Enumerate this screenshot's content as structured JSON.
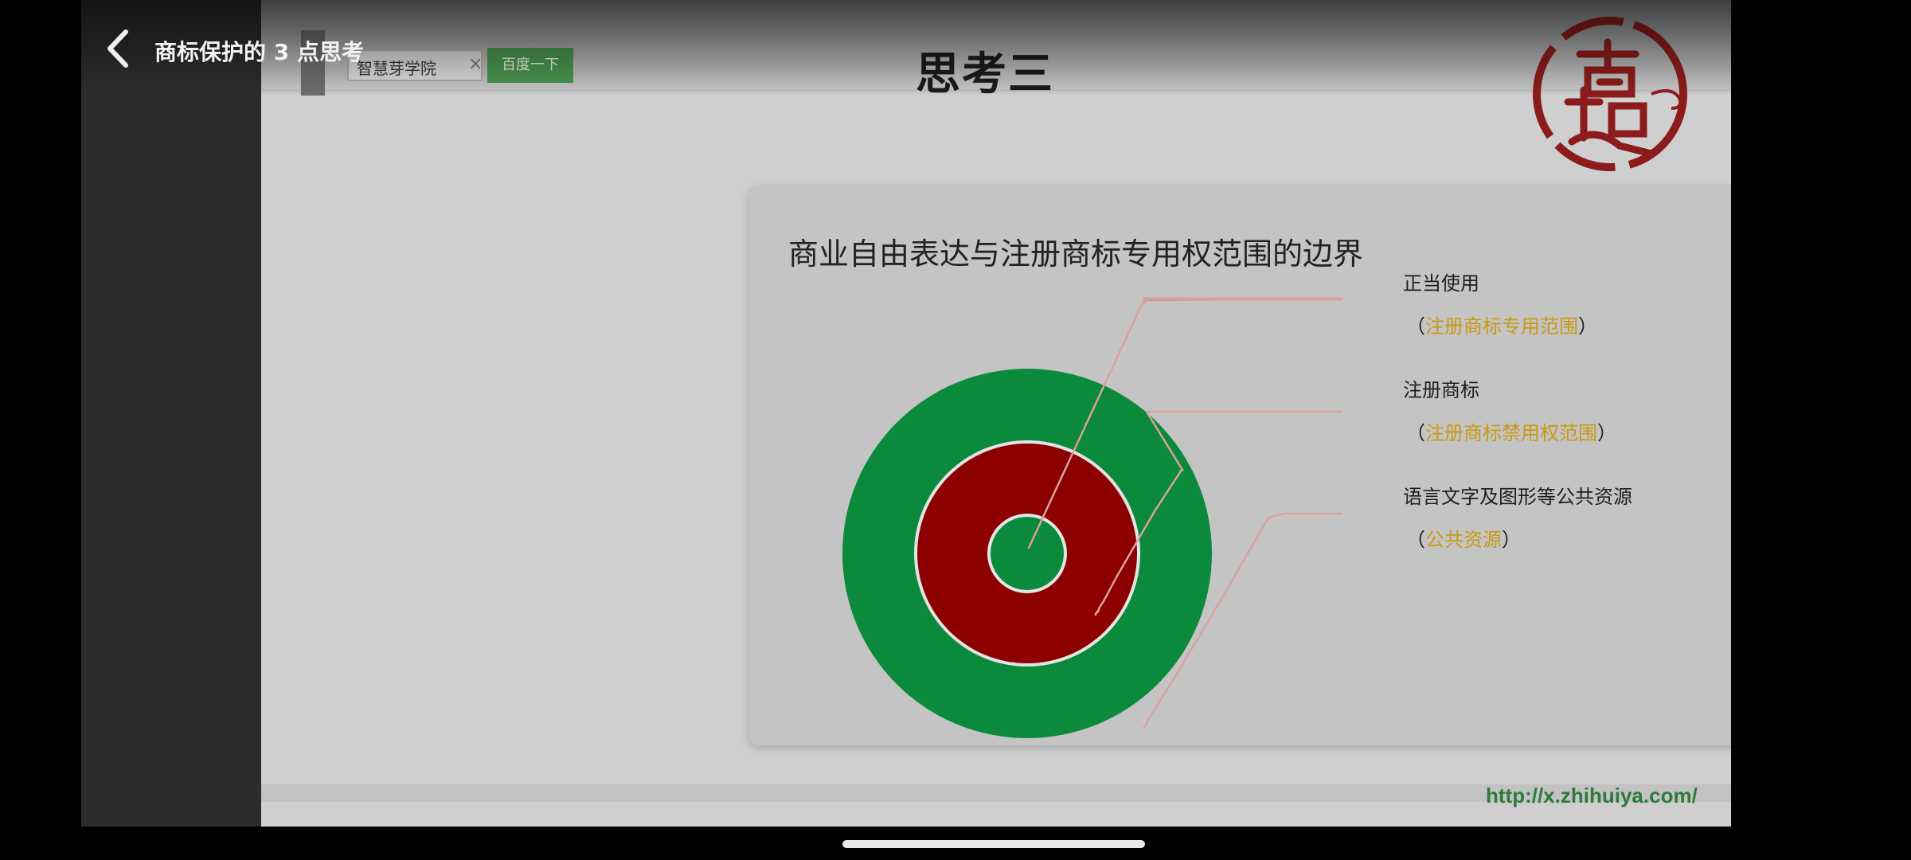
{
  "nav": {
    "title": "商标保护的 3 点思考"
  },
  "slide": {
    "title": "思考三",
    "search_box_text": "智慧芽学院",
    "search_button": "百度一下",
    "url": "http://x.zhihuiya.com/"
  },
  "card": {
    "title": "商业自由表达与注册商标专用权范围的边界"
  },
  "labels": [
    {
      "main": "正当使用",
      "open": "（",
      "highlight": "注册商标专用范围",
      "close": "）"
    },
    {
      "main": "注册商标",
      "open": "（",
      "highlight": "注册商标禁用权范围",
      "close": "）"
    },
    {
      "main": "语言文字及图形等公共资源",
      "open": "（",
      "highlight": "公共资源",
      "close": "）"
    }
  ],
  "colors": {
    "outer_ring": "#0a8a3a",
    "middle_ring": "#8c0000",
    "inner_circle": "#0a8a3a",
    "highlight_text": "#c99a13",
    "leader_line": "#d98a8a"
  }
}
